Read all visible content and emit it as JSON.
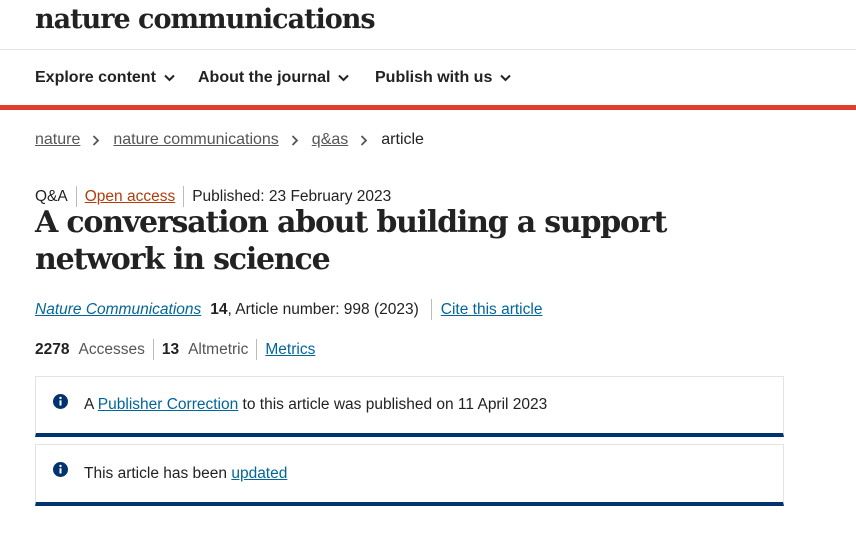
{
  "header": {
    "logo": "nature communications"
  },
  "nav": [
    {
      "label": "Explore content"
    },
    {
      "label": "About the journal"
    },
    {
      "label": "Publish with us"
    }
  ],
  "breadcrumb": {
    "items": [
      "nature",
      "nature communications",
      "q&as"
    ],
    "current": "article"
  },
  "article": {
    "type": "Q&A",
    "access": "Open access",
    "published": "Published: 23 February 2023",
    "title": "A conversation about building a support network in science",
    "journal": "Nature Communications",
    "volume": "14",
    "article_number_text": ", Article number: 998 (2023)",
    "cite_label": "Cite this article"
  },
  "metrics": {
    "accesses_count": "2278",
    "accesses_label": "Accesses",
    "altmetric_count": "13",
    "altmetric_label": "Altmetric",
    "metrics_link": "Metrics"
  },
  "notices": [
    {
      "prefix": "A ",
      "link": "Publisher Correction",
      "suffix": " to this article was published on 11 April 2023"
    },
    {
      "prefix": "This article has been ",
      "link": "updated",
      "suffix": ""
    }
  ],
  "colors": {
    "accent_red": "#e0402b",
    "link_blue": "#006699",
    "open_access_orange": "#b23c0b",
    "notice_bar_navy": "#01346e"
  },
  "icons": [
    "chevron-down-icon",
    "chevron-right-icon",
    "info-icon"
  ]
}
